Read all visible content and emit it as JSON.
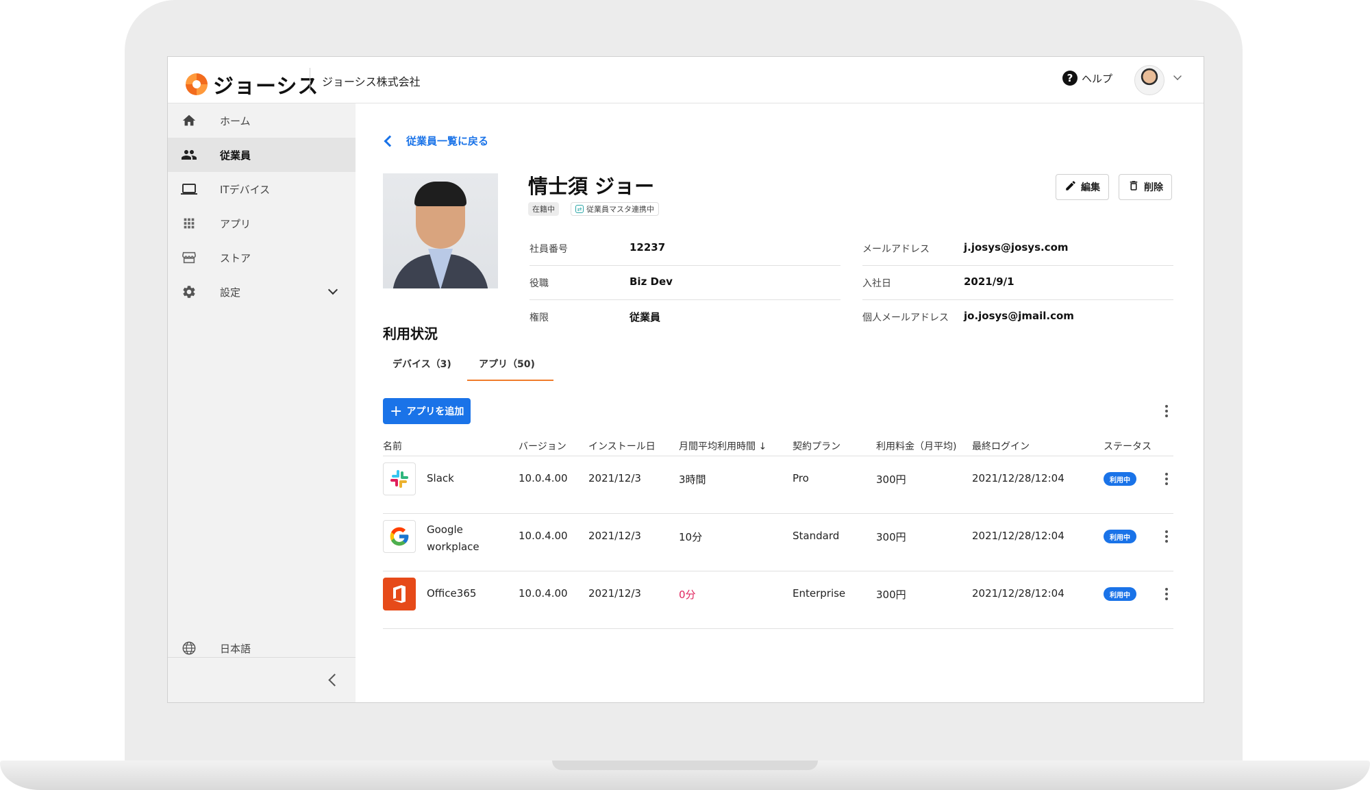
{
  "header": {
    "logo_text": "ジョーシス",
    "company": "ジョーシス株式会社",
    "help_label": "ヘルプ"
  },
  "sidebar": {
    "items": [
      {
        "label": "ホーム",
        "icon": "home-icon"
      },
      {
        "label": "従業員",
        "icon": "people-icon"
      },
      {
        "label": "ITデバイス",
        "icon": "laptop-icon"
      },
      {
        "label": "アプリ",
        "icon": "apps-grid-icon"
      },
      {
        "label": "ストア",
        "icon": "store-icon"
      },
      {
        "label": "設定",
        "icon": "gear-icon"
      }
    ],
    "active_index": 1,
    "language_label": "日本語"
  },
  "main": {
    "back_label": "従業員一覧に戻る",
    "employee": {
      "name": "情士須 ジョー",
      "status_chip": "在籍中",
      "sync_chip": "従業員マスタ連携中"
    },
    "actions": {
      "edit_label": "編集",
      "delete_label": "削除"
    },
    "info": {
      "left": [
        {
          "label": "社員番号",
          "value": "12237"
        },
        {
          "label": "役職",
          "value": "Biz Dev"
        },
        {
          "label": "権限",
          "value": "従業員"
        }
      ],
      "right": [
        {
          "label": "メールアドレス",
          "value": "j.josys@josys.com"
        },
        {
          "label": "入社日",
          "value": "2021/9/1"
        },
        {
          "label": "個人メールアドレス",
          "value": "jo.josys@jmail.com"
        }
      ]
    },
    "usage_title": "利用状況",
    "tabs": [
      {
        "label": "デバイス（3)"
      },
      {
        "label": "アプリ（50)"
      }
    ],
    "active_tab": 1,
    "add_app_label": "アプリを追加",
    "table": {
      "columns": [
        "名前",
        "バージョン",
        "インストール日",
        "月間平均利用時間 ↓",
        "契約プラン",
        "利用料金（月平均)",
        "最終ログイン",
        "ステータス"
      ],
      "rows": [
        {
          "name": "Slack",
          "version": "10.0.4.00",
          "install": "2021/12/3",
          "usage": "3時間",
          "plan": "Pro",
          "fee": "300円",
          "last_login": "2021/12/28/12:04",
          "status": "利用中"
        },
        {
          "name": "Google workplace",
          "version": "10.0.4.00",
          "install": "2021/12/3",
          "usage": "10分",
          "plan": "Standard",
          "fee": "300円",
          "last_login": "2021/12/28/12:04",
          "status": "利用中"
        },
        {
          "name": "Office365",
          "version": "10.0.4.00",
          "install": "2021/12/3",
          "usage": "0分",
          "plan": "Enterprise",
          "fee": "300円",
          "last_login": "2021/12/28/12:04",
          "status": "利用中"
        }
      ]
    }
  },
  "colors": {
    "primary": "#1a73e8",
    "accent": "#f07b2a",
    "warning_text": "#e0245e",
    "sidebar_bg": "#f2f2f2"
  }
}
